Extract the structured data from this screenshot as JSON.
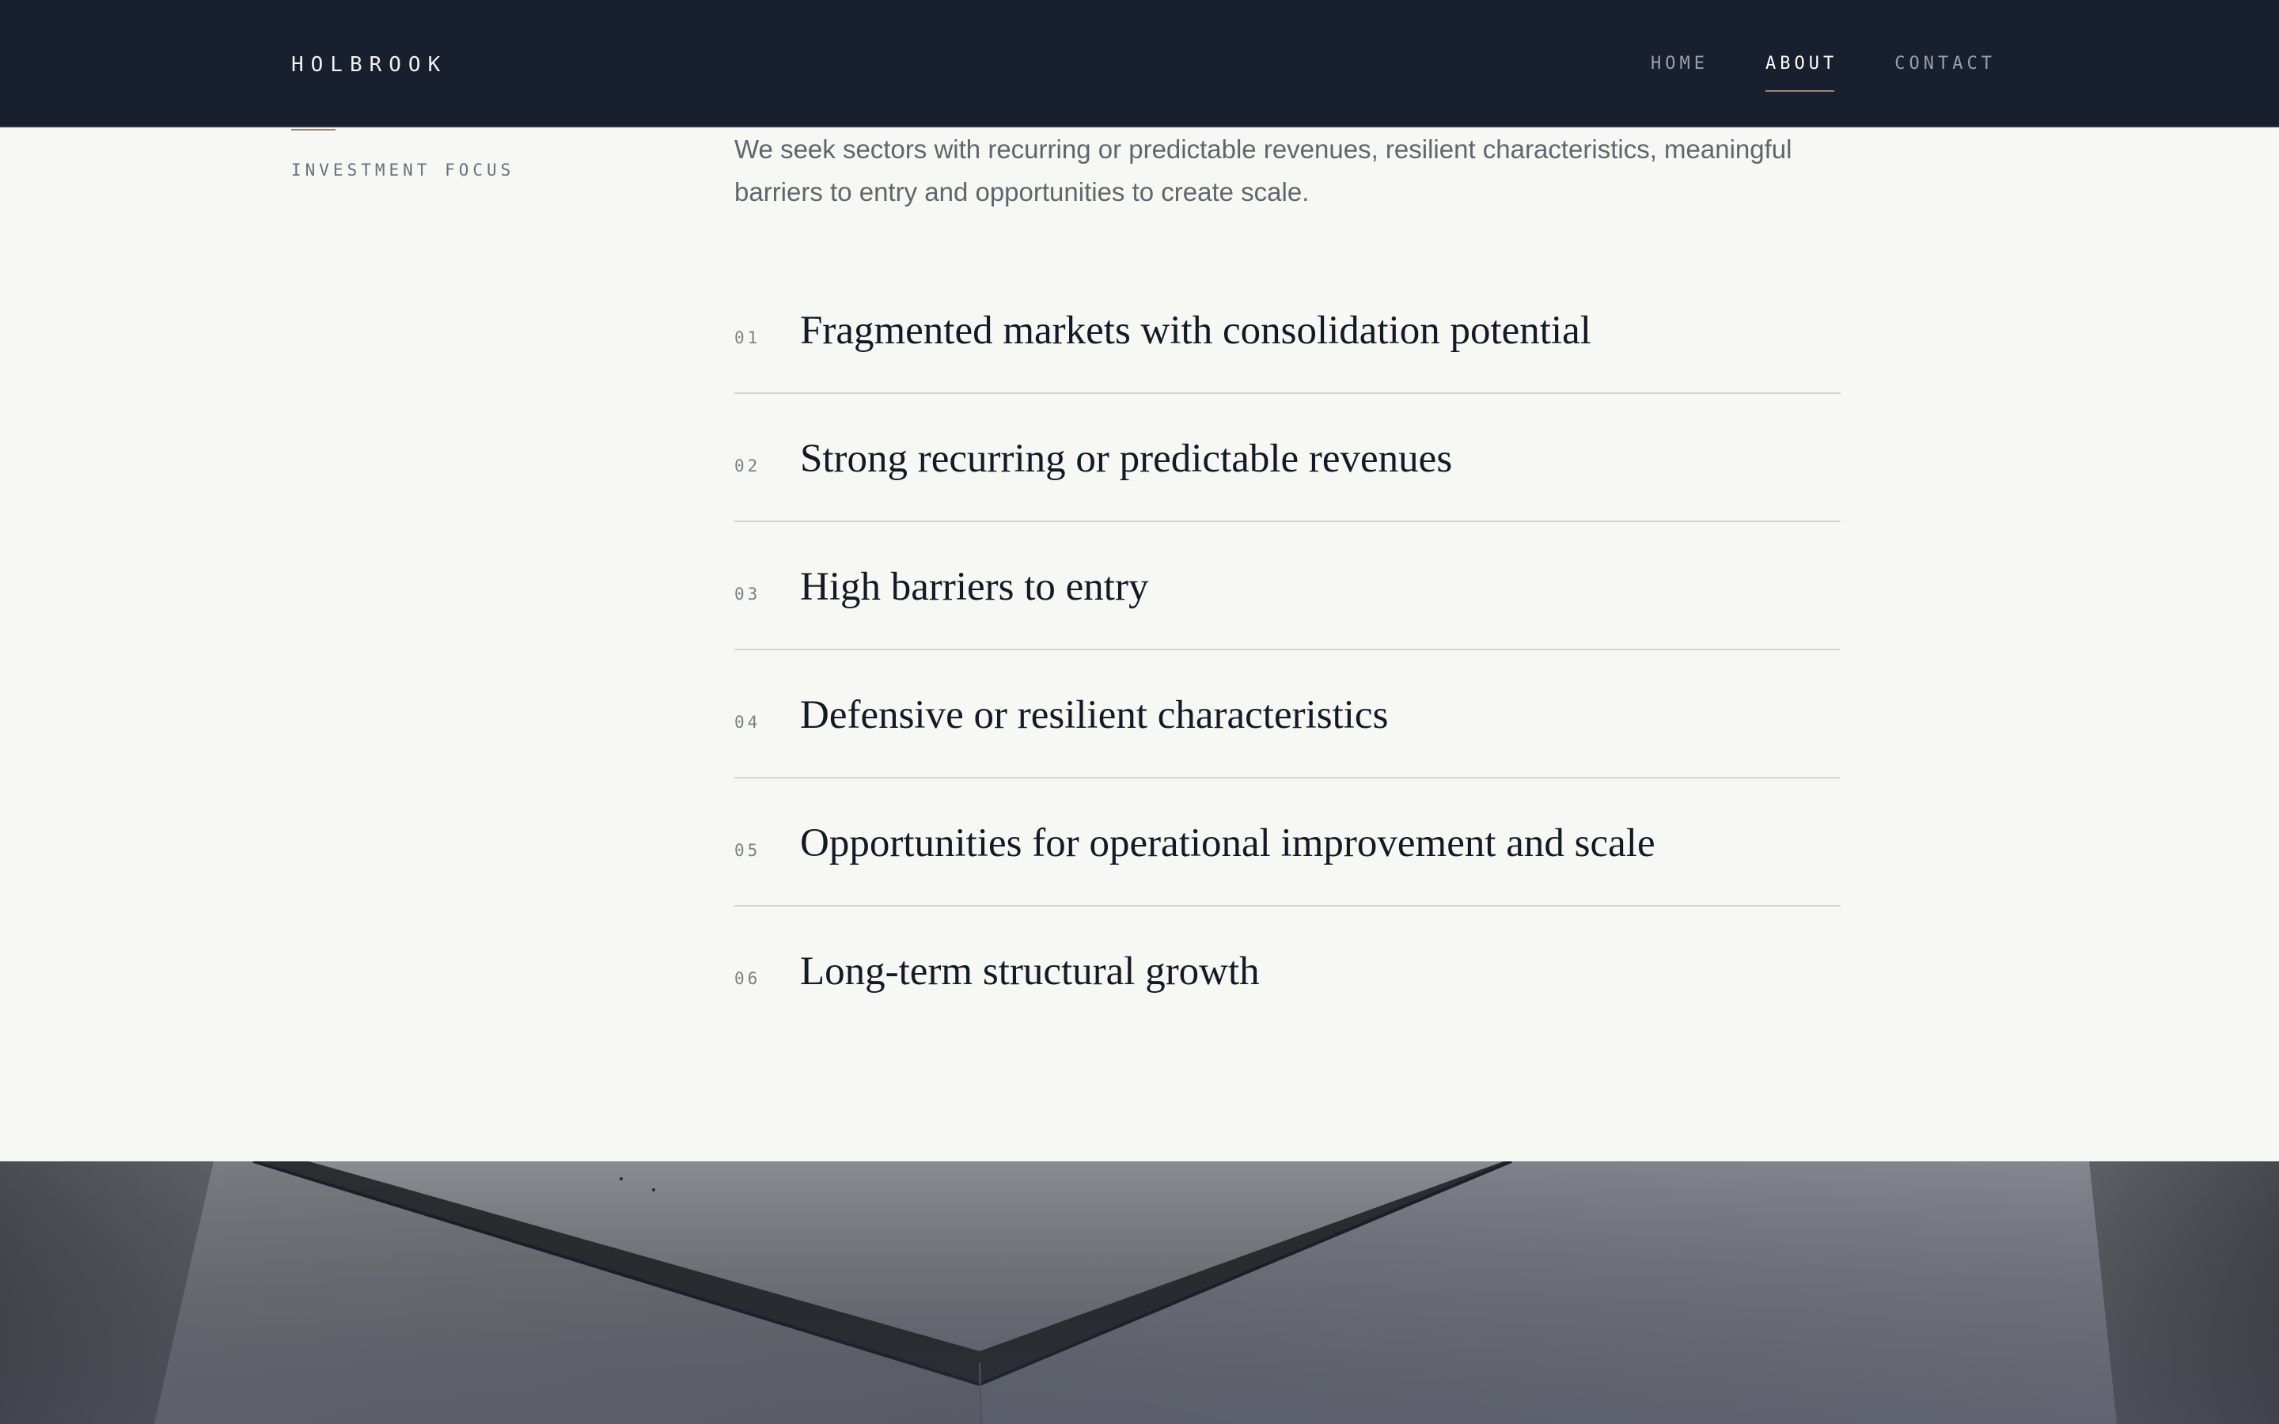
{
  "header": {
    "brand": "HOLBROOK",
    "nav": [
      {
        "label": "HOME",
        "active": false
      },
      {
        "label": "ABOUT",
        "active": true
      },
      {
        "label": "CONTACT",
        "active": false
      }
    ]
  },
  "section": {
    "label": "INVESTMENT FOCUS",
    "intro": "We seek sectors with recurring or predictable revenues, resilient characteristics, meaningful barriers to entry and opportunities to create scale.",
    "items": [
      {
        "number": "01",
        "title": "Fragmented markets with consolidation potential"
      },
      {
        "number": "02",
        "title": "Strong recurring or predictable revenues"
      },
      {
        "number": "03",
        "title": "High barriers to entry"
      },
      {
        "number": "04",
        "title": "Defensive or resilient characteristics"
      },
      {
        "number": "05",
        "title": "Opportunities for operational improvement and scale"
      },
      {
        "number": "06",
        "title": "Long-term structural growth"
      }
    ]
  },
  "colors": {
    "header_bg": "#181f2e",
    "page_bg": "#f7f7f3",
    "accent": "#9b8873",
    "heading_text": "#141927",
    "body_text": "#60656e",
    "divider": "#d5d5cf"
  }
}
